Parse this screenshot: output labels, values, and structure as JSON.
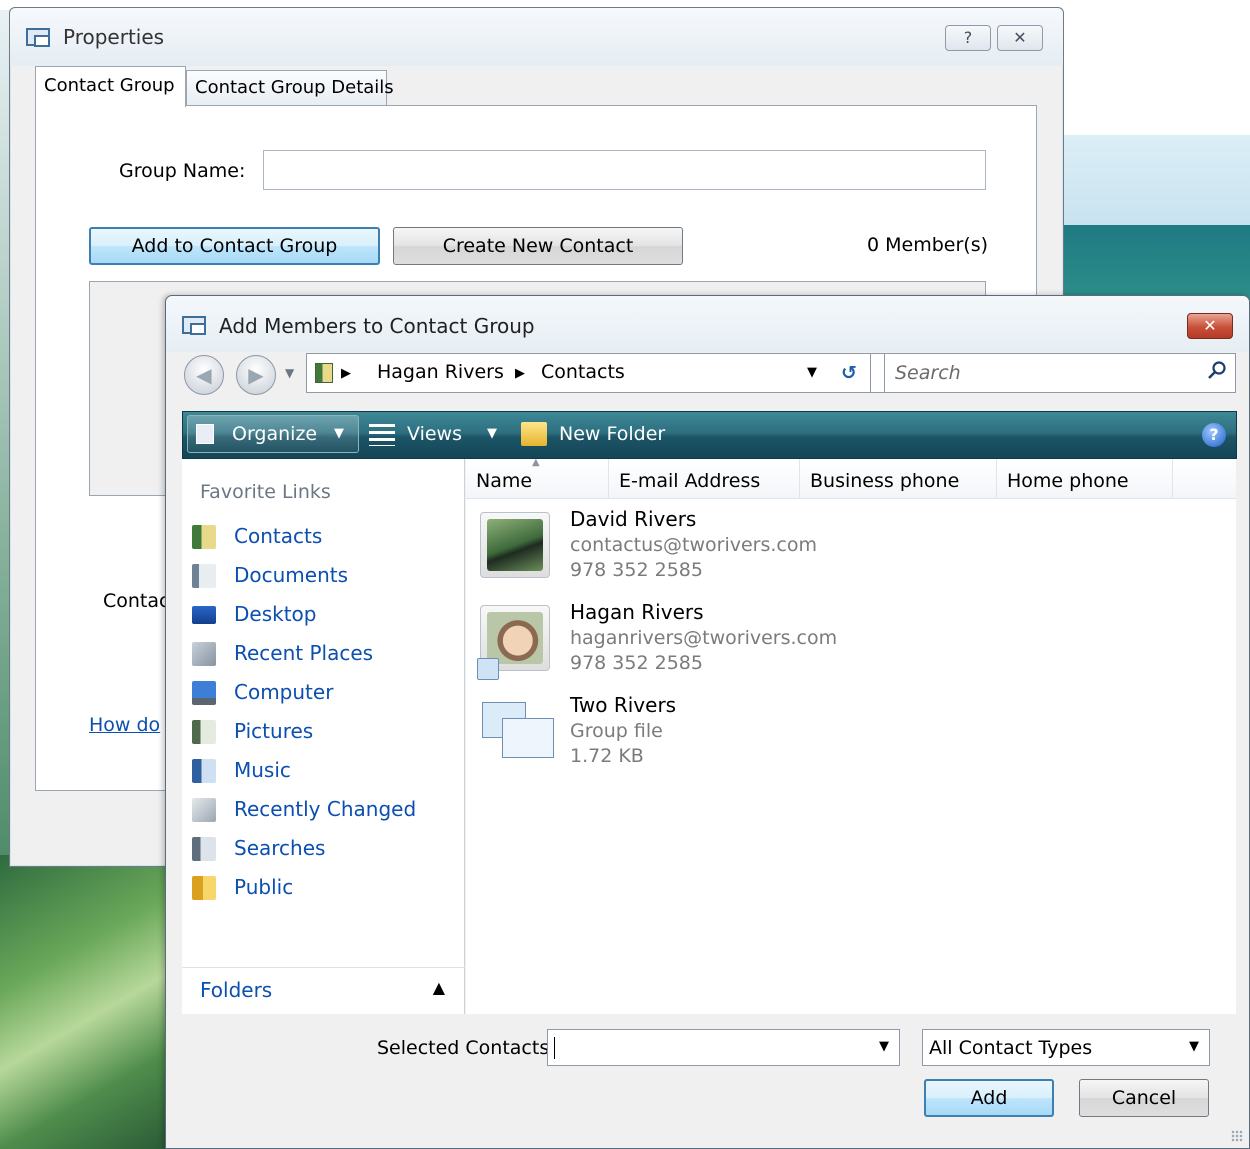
{
  "properties": {
    "title": "Properties",
    "help_glyph": "?",
    "close_glyph": "✕",
    "tabs": [
      "Contact Group",
      "Contact Group Details"
    ],
    "group_name_label": "Group Name:",
    "group_name_value": "",
    "add_button": "Add to Contact Group",
    "create_button": "Create New Contact",
    "member_count": "0 Member(s)",
    "contact_partial": "Contac",
    "howdo_partial": "How do"
  },
  "dialog": {
    "title": "Add Members to Contact Group",
    "close_glyph": "✕",
    "breadcrumb": [
      "Hagan Rivers",
      "Contacts"
    ],
    "search_placeholder": "Search",
    "toolbar": {
      "organize": "Organize",
      "views": "Views",
      "new_folder": "New Folder",
      "help": "?"
    },
    "favorite_links_header": "Favorite Links",
    "favorites": [
      {
        "label": "Contacts",
        "icon": "contacts-icon"
      },
      {
        "label": "Documents",
        "icon": "documents-icon"
      },
      {
        "label": "Desktop",
        "icon": "desktop-icon"
      },
      {
        "label": "Recent Places",
        "icon": "recent-places-icon"
      },
      {
        "label": "Computer",
        "icon": "computer-icon"
      },
      {
        "label": "Pictures",
        "icon": "pictures-icon"
      },
      {
        "label": "Music",
        "icon": "music-icon"
      },
      {
        "label": "Recently Changed",
        "icon": "recently-changed-icon"
      },
      {
        "label": "Searches",
        "icon": "searches-icon"
      },
      {
        "label": "Public",
        "icon": "public-icon"
      }
    ],
    "folders_label": "Folders",
    "columns": [
      "Name",
      "E-mail Address",
      "Business phone",
      "Home phone"
    ],
    "items": [
      {
        "name": "David Rivers",
        "line1": "contactus@tworivers.com",
        "line2": "978 352 2585"
      },
      {
        "name": "Hagan Rivers",
        "line1": "haganrivers@tworivers.com",
        "line2": "978 352 2585"
      },
      {
        "name": "Two Rivers",
        "line1": "Group file",
        "line2": "1.72 KB"
      }
    ],
    "selected_contacts_label": "Selected Contacts:",
    "selected_contacts_value": "",
    "contact_type": "All Contact Types",
    "add_button": "Add",
    "cancel_button": "Cancel"
  },
  "colors": {
    "toolbar": "#2d6f80",
    "link": "#0b4fb0",
    "focus_button": "#3c7fb1",
    "close_button": "#c8513a"
  }
}
